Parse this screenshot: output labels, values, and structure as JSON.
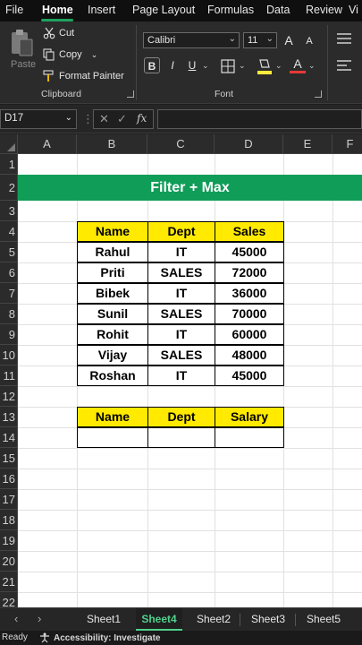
{
  "menu": {
    "tabs": [
      "File",
      "Home",
      "Insert",
      "Page Layout",
      "Formulas",
      "Data",
      "Review",
      "Vi"
    ],
    "active": "Home"
  },
  "ribbon": {
    "clipboard": {
      "paste_label": "Paste",
      "cut_label": "Cut",
      "copy_label": "Copy",
      "format_painter_label": "Format Painter",
      "group_label": "Clipboard"
    },
    "font": {
      "font_name": "Calibri",
      "font_size": "11",
      "group_label": "Font",
      "bold": "B",
      "italic": "I",
      "underline": "U",
      "grow": "A",
      "shrink": "A",
      "font_color_letter": "A"
    }
  },
  "formula_bar": {
    "name_box": "D17",
    "fx_label": "fx",
    "formula": ""
  },
  "grid": {
    "columns": [
      "A",
      "B",
      "C",
      "D",
      "E",
      "F"
    ],
    "rows": [
      "1",
      "2",
      "3",
      "4",
      "5",
      "6",
      "7",
      "8",
      "9",
      "10",
      "11",
      "12",
      "13",
      "14",
      "15",
      "16",
      "17",
      "18",
      "19",
      "20",
      "21",
      "22"
    ],
    "banner_title": "Filter + Max",
    "table1": {
      "headers": [
        "Name",
        "Dept",
        "Sales"
      ],
      "rows": [
        [
          "Rahul",
          "IT",
          "45000"
        ],
        [
          "Priti",
          "SALES",
          "72000"
        ],
        [
          "Bibek",
          "IT",
          "36000"
        ],
        [
          "Sunil",
          "SALES",
          "70000"
        ],
        [
          "Rohit",
          "IT",
          "60000"
        ],
        [
          "Vijay",
          "SALES",
          "48000"
        ],
        [
          "Roshan",
          "IT",
          "45000"
        ]
      ]
    },
    "table2": {
      "headers": [
        "Name",
        "Dept",
        "Salary"
      ],
      "rows": [
        [
          "",
          "",
          ""
        ]
      ]
    }
  },
  "sheets": {
    "tabs": [
      "Sheet1",
      "Sheet4",
      "Sheet2",
      "Sheet3",
      "Sheet5"
    ],
    "active": "Sheet4",
    "prev_arrow": "‹",
    "next_arrow": "›"
  },
  "status": {
    "ready": "Ready",
    "accessibility": "Accessibility: Investigate"
  },
  "colors": {
    "banner": "#0f9d58",
    "header_fill": "#ffea00",
    "accent": "#1ea260"
  }
}
